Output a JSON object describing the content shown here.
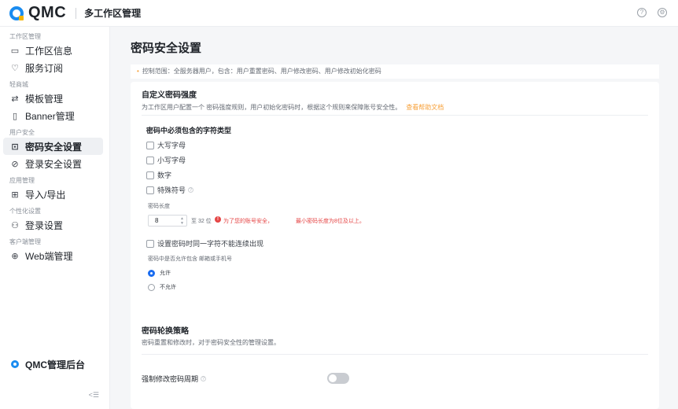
{
  "header": {
    "brand": "QMC",
    "title": "多工作区管理",
    "help_icon": "question-circle-icon",
    "settings_icon": "gear-icon"
  },
  "sidebar": {
    "groups": [
      {
        "title": "工作区管理",
        "items": [
          {
            "label": "工作区信息",
            "icon": "monitor-icon"
          },
          {
            "label": "服务订阅",
            "icon": "heart-icon"
          }
        ]
      },
      {
        "title": "轻商城",
        "items": [
          {
            "label": "模板管理",
            "icon": "swap-icon"
          },
          {
            "label": "Banner管理",
            "icon": "banner-icon"
          }
        ]
      },
      {
        "title": "用户安全",
        "items": [
          {
            "label": "密码安全设置",
            "icon": "lock-icon",
            "active": true
          },
          {
            "label": "登录安全设置",
            "icon": "shield-check-icon"
          }
        ]
      },
      {
        "title": "应用管理",
        "items": [
          {
            "label": "导入/导出",
            "icon": "grid-icon"
          }
        ]
      },
      {
        "title": "个性化设置",
        "items": [
          {
            "label": "登录设置",
            "icon": "user-icon"
          }
        ]
      },
      {
        "title": "客户端管理",
        "items": [
          {
            "label": "Web端管理",
            "icon": "globe-icon"
          }
        ]
      }
    ],
    "footer_brand": "QMC管理后台",
    "collapse_icon": "collapse-icon"
  },
  "main": {
    "page_title": "密码安全设置",
    "notice": "控制范围：全服务器用户，包含：用户重置密码、用户修改密码、用户修改初始化密码",
    "strength": {
      "title": "自定义密码强度",
      "desc": "为工作区用户配置一个 密码强度规则，用户初始化密码时，根据这个规则来保障账号安全性。",
      "help_link": "查看帮助文档",
      "char_types_title": "密码中必须包含的字符类型",
      "char_types": [
        {
          "label": "大写字母",
          "checked": false
        },
        {
          "label": "小写字母",
          "checked": false
        },
        {
          "label": "数字",
          "checked": false
        },
        {
          "label": "特殊符号",
          "checked": false
        }
      ],
      "length_label": "密码长度",
      "length_value": "8",
      "length_suffix": "至 32 位",
      "error_text_1": "为了您的账号安全，",
      "error_text_2": "最小密码长度为8位及以上。",
      "consecutive_label": "设置密码时同一字符不能连续出现",
      "consecutive_checked": false,
      "contain_info_label": "密码中是否允许包含 邮箱或手机号",
      "options": [
        {
          "label": "允许",
          "selected": true
        },
        {
          "label": "不允许",
          "selected": false
        }
      ]
    },
    "rotation": {
      "title": "密码轮换策略",
      "desc": "密码重置和修改时，对于密码安全性的管理设置。",
      "force_label": "强制修改密码周期",
      "force_enabled": false
    }
  }
}
